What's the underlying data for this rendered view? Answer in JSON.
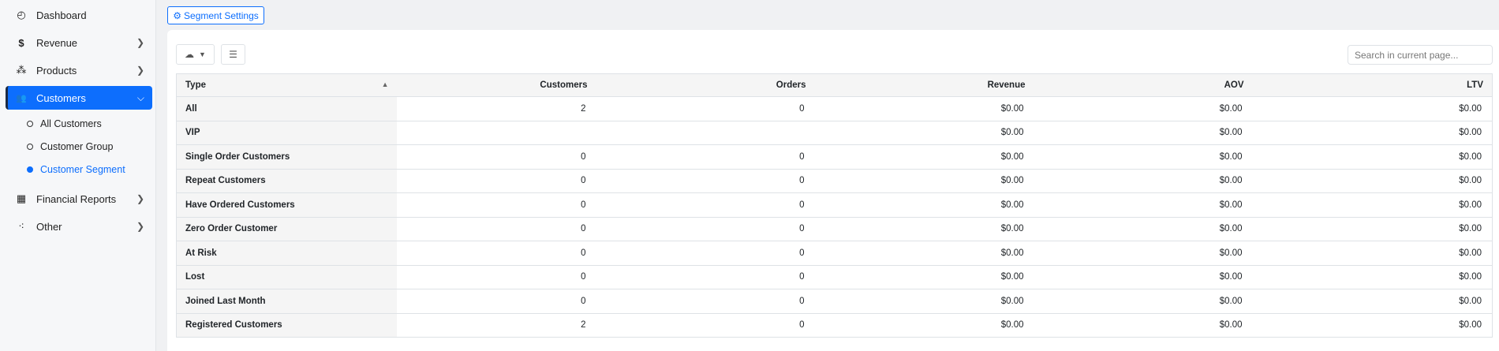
{
  "sidebar": {
    "items": [
      {
        "label": "Dashboard",
        "icon": "dashboard-icon",
        "glyph": "◴"
      },
      {
        "label": "Revenue",
        "icon": "dollar-icon",
        "glyph": "$"
      },
      {
        "label": "Products",
        "icon": "products-icon",
        "glyph": "⁂"
      },
      {
        "label": "Customers",
        "icon": "users-icon",
        "glyph": "👥"
      },
      {
        "label": "Financial Reports",
        "icon": "clipboard-icon",
        "glyph": "▦"
      },
      {
        "label": "Other",
        "icon": "sitemap-icon",
        "glyph": "⁖"
      }
    ],
    "sub_items": [
      {
        "label": "All Customers"
      },
      {
        "label": "Customer Group"
      },
      {
        "label": "Customer Segment"
      }
    ]
  },
  "segment_settings_label": "Segment Settings",
  "search_placeholder": "Search in current page...",
  "columns": [
    "Type",
    "Customers",
    "Orders",
    "Revenue",
    "AOV",
    "LTV"
  ],
  "rows": [
    [
      "All",
      "2",
      "0",
      "$0.00",
      "$0.00",
      "$0.00"
    ],
    [
      "VIP",
      "",
      "",
      "$0.00",
      "$0.00",
      "$0.00"
    ],
    [
      "Single Order Customers",
      "0",
      "0",
      "$0.00",
      "$0.00",
      "$0.00"
    ],
    [
      "Repeat Customers",
      "0",
      "0",
      "$0.00",
      "$0.00",
      "$0.00"
    ],
    [
      "Have Ordered Customers",
      "0",
      "0",
      "$0.00",
      "$0.00",
      "$0.00"
    ],
    [
      "Zero Order Customer",
      "0",
      "0",
      "$0.00",
      "$0.00",
      "$0.00"
    ],
    [
      "At Risk",
      "0",
      "0",
      "$0.00",
      "$0.00",
      "$0.00"
    ],
    [
      "Lost",
      "0",
      "0",
      "$0.00",
      "$0.00",
      "$0.00"
    ],
    [
      "Joined Last Month",
      "0",
      "0",
      "$0.00",
      "$0.00",
      "$0.00"
    ],
    [
      "Registered Customers",
      "2",
      "0",
      "$0.00",
      "$0.00",
      "$0.00"
    ]
  ]
}
